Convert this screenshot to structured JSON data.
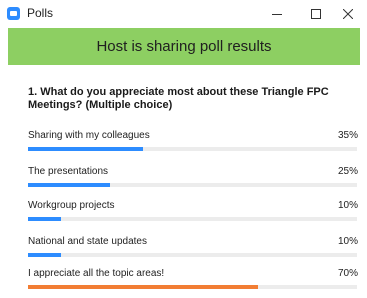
{
  "window": {
    "title": "Polls"
  },
  "banner": {
    "text": "Host is sharing poll results"
  },
  "poll": {
    "question": "1. What do you appreciate most about these Triangle FPC Meetings? (Multiple choice)",
    "colors": {
      "bar": "#2d8cff",
      "top_bar": "#f27d33",
      "track": "#ececec",
      "banner": "#8dcf62"
    },
    "options": [
      {
        "label": "Sharing with my colleagues",
        "percent": "35%",
        "value": 35
      },
      {
        "label": "The presentations",
        "percent": "25%",
        "value": 25
      },
      {
        "label": "Workgroup projects",
        "percent": "10%",
        "value": 10
      },
      {
        "label": "National and state updates",
        "percent": "10%",
        "value": 10
      },
      {
        "label": "I appreciate all the topic areas!",
        "percent": "70%",
        "value": 70,
        "highlight": true
      }
    ]
  }
}
